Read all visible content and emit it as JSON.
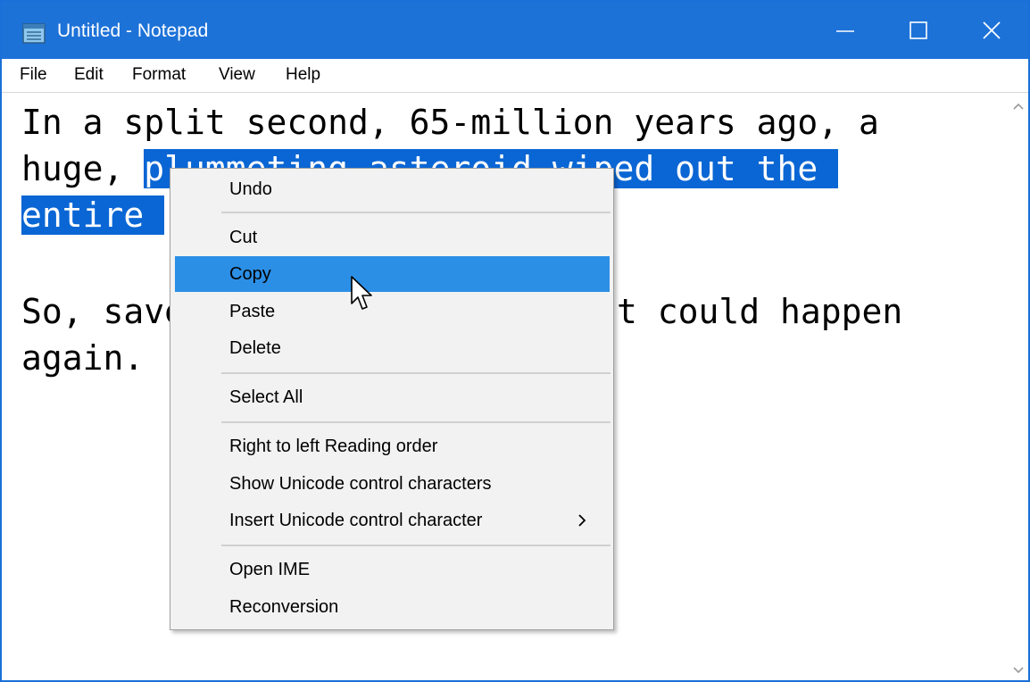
{
  "window": {
    "title": "Untitled - Notepad"
  },
  "menubar": {
    "items": [
      "File",
      "Edit",
      "Format",
      "View",
      "Help"
    ]
  },
  "editor": {
    "line1": "In a split second, 65-million years ago, a",
    "line2_plain": "huge, ",
    "line2_selected": "plummeting asteroid wiped out the ",
    "line3_selected": "entire ",
    "line5": "So, save",
    "line5_end": "t could happen",
    "line6": "again."
  },
  "context_menu": {
    "undo": "Undo",
    "cut": "Cut",
    "copy": "Copy",
    "paste": "Paste",
    "delete": "Delete",
    "select_all": "Select All",
    "rtl": "Right to left Reading order",
    "show_unicode": "Show Unicode control characters",
    "insert_unicode": "Insert Unicode control character",
    "open_ime": "Open IME",
    "reconversion": "Reconversion"
  },
  "icons": {
    "app": "notepad-icon",
    "minimize": "minimize-icon",
    "maximize": "maximize-icon",
    "close": "close-icon",
    "submenu": "chevron-right-icon",
    "cursor": "mouse-pointer-icon"
  },
  "colors": {
    "titlebar": "#1d72d8",
    "selection": "#0a66d4",
    "menu_hover": "#2c8fe6"
  }
}
